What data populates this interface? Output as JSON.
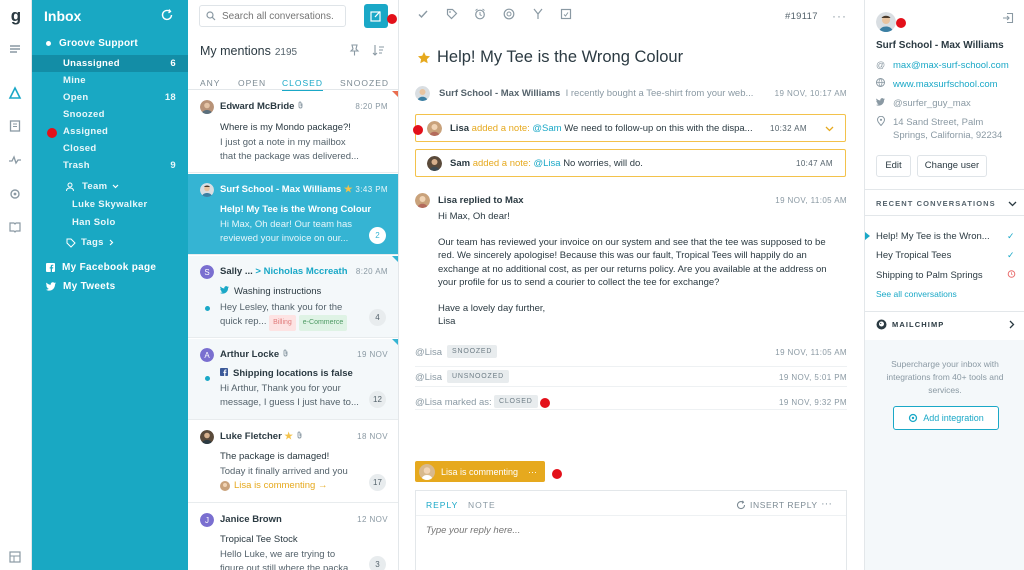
{
  "sidebar": {
    "title": "Inbox",
    "group": "Groove Support",
    "items": [
      {
        "label": "Unassigned",
        "count": "6"
      },
      {
        "label": "Mine",
        "count": ""
      },
      {
        "label": "Open",
        "count": "18"
      },
      {
        "label": "Snoozed",
        "count": ""
      },
      {
        "label": "Assigned",
        "count": ""
      },
      {
        "label": "Closed",
        "count": ""
      },
      {
        "label": "Trash",
        "count": "9"
      }
    ],
    "team_label": "Team",
    "team_members": [
      "Luke Skywalker",
      "Han Solo"
    ],
    "tags_label": "Tags",
    "facebook": "My Facebook page",
    "tweets": "My Tweets"
  },
  "list": {
    "search_placeholder": "Search all conversations...",
    "title": "My mentions",
    "count": "2195",
    "tabs": [
      "ANY",
      "OPEN",
      "CLOSED",
      "SNOOZED"
    ],
    "conversations": [
      {
        "name": "Edward McBride",
        "time": "8:20 PM",
        "subject": "Where is my Mondo package?!",
        "preview1": "I just got a note in my mailbox",
        "preview2": "that the package was delivered..."
      },
      {
        "name": "Surf School - Max Williams",
        "time": "3:43 PM",
        "subject": "Help! My Tee is the Wrong Colour",
        "preview1": "Hi Max, Oh dear! Our team has",
        "preview2": "reviewed your invoice on our...",
        "count": "2"
      },
      {
        "name": "Sally ...",
        "to": "> Nicholas Mccreath",
        "time": "8:20 AM",
        "subject": "Washing instructions",
        "preview1": "Hey Lesley, thank you for the",
        "preview2": "quick rep...",
        "tag1": "Billing",
        "tag2": "e-Commerce",
        "count": "4"
      },
      {
        "name": "Arthur Locke",
        "time": "19 NOV",
        "subject": "Shipping locations is false",
        "preview1": "Hi Arthur, Thank you for your",
        "preview2": "message, I guess I just have to...",
        "count": "12"
      },
      {
        "name": "Luke Fletcher",
        "time": "18 NOV",
        "subject": "The package is damaged!",
        "preview1": "Today it finally arrived and you",
        "preview2": "Lisa is commenting →",
        "count": "17"
      },
      {
        "name": "Janice Brown",
        "time": "12 NOV",
        "subject": "Tropical Tee Stock",
        "preview1": "Hello Luke, we are trying to",
        "preview2": "figure out still where the packa...",
        "count": "3"
      }
    ]
  },
  "main": {
    "ticket_id": "#19117",
    "more": "···",
    "subject": "Help! My Tee is the Wrong Colour",
    "event1": {
      "name": "Surf School - Max Williams",
      "text": "I recently bought a Tee-shirt from your web...",
      "time": "19 NOV, 10:17 AM"
    },
    "note1": {
      "name": "Lisa",
      "action": "added a note:",
      "mention": "@Sam",
      "text": "We need to follow-up on this with the dispa...",
      "time": "10:32 AM"
    },
    "note2": {
      "name": "Sam",
      "action": "added a note:",
      "mention": "@Lisa",
      "text": "No worries, will do.",
      "time": "10:47 AM"
    },
    "reply": {
      "header": "Lisa replied to Max",
      "time": "19 NOV, 11:05 AM",
      "p1": "Hi Max, Oh dear!",
      "p2": "Our team has reviewed your invoice on our system and see that the tee was supposed to be red. We sincerely apologise! Because this was our fault, Tropical Tees will happily do an exchange at no additional cost, as per our returns policy. Are you available at the address on your profile for us to send a courier to collect the tee for exchange?",
      "p3": "Have a lovely day further,",
      "p4": "Lisa"
    },
    "status": [
      {
        "who": "@Lisa",
        "pill": "SNOOZED",
        "time": "19 NOV, 11:05 AM"
      },
      {
        "who": "@Lisa",
        "pill": "UNSNOOZED",
        "time": "19 NOV, 5:01 PM"
      },
      {
        "who": "@Lisa marked as:",
        "pill": "CLOSED",
        "time": "19 NOV, 9:32 PM"
      }
    ],
    "typing": "Lisa is commenting",
    "typing_more": "···",
    "reply_box": {
      "tab_reply": "REPLY",
      "tab_note": "NOTE",
      "insert": "INSERT REPLY",
      "more": "···",
      "placeholder": "Type your reply here..."
    }
  },
  "customer": {
    "name": "Surf School - Max Williams",
    "email": "max@max-surf-school.com",
    "website": "www.maxsurfschool.com",
    "twitter": "@surfer_guy_max",
    "address1": "14 Sand Street, Palm",
    "address2": "Springs, California, 92234",
    "edit": "Edit",
    "change_user": "Change user",
    "recent_title": "RECENT CONVERSATIONS",
    "recent": [
      "Help! My Tee is the Wron...",
      "Hey Tropical Tees",
      "Shipping to Palm Springs"
    ],
    "see_all": "See all conversations",
    "mailchimp": "MAILCHIMP",
    "promo": "Supercharge your inbox with integrations from 40+ tools and services.",
    "add_integration": "Add integration"
  },
  "colors": {
    "accent": "#1aa8c7",
    "sidebar": "#19a8c3",
    "note_border": "#f3c24b",
    "commenting": "#e6a91e",
    "marker": "#e3101a"
  }
}
